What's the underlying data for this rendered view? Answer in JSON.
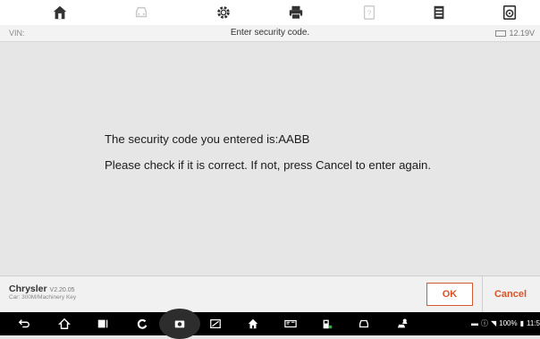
{
  "toolbar": {
    "icons": [
      "home-icon",
      "car-icon",
      "settings-icon",
      "print-icon",
      "help-icon",
      "data-icon",
      "disk-icon"
    ]
  },
  "infobar": {
    "vin_label": "VIN:",
    "title": "Enter security code.",
    "battery": "12.19V"
  },
  "message": {
    "line1": "The security code you entered is:AABB",
    "line2": "Please check if it is correct. If not, press Cancel to enter again."
  },
  "footer": {
    "brand": "Chrysler",
    "version": "V2.20.05",
    "car": "Car: 300M/Machinery Key",
    "ok_label": "OK",
    "cancel_label": "Cancel"
  },
  "status": {
    "battery_percent": "100%",
    "time": "11:5"
  },
  "colors": {
    "accent": "#d9532a",
    "toolbar_bg": "#ffffff",
    "main_bg": "#e6e6e6",
    "navbar_bg": "#000000"
  }
}
